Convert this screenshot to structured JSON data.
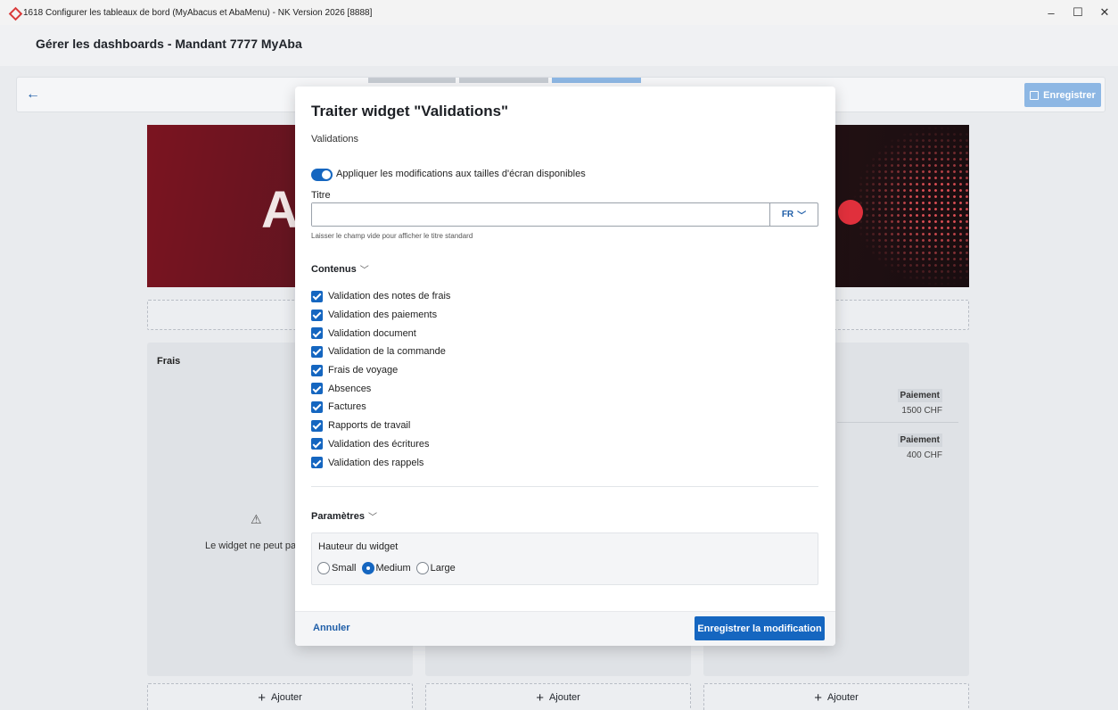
{
  "window": {
    "title": "1618 Configurer les tableaux de bord (MyAbacus et AbaMenu) - NK Version 2026 [8888]",
    "controls": {
      "minimize": "–",
      "maximize": "☐",
      "close": "✕"
    }
  },
  "header": {
    "title": "Gérer les dashboards - Mandant 7777 MyAba"
  },
  "toolbar": {
    "back_icon": "←",
    "save_label": "Enregistrer"
  },
  "dashboard": {
    "banner_letter": "A",
    "column1": {
      "title": "Frais",
      "warning_icon": "⚠",
      "warning_text": "Le widget ne peut pas"
    },
    "column3": {
      "payments": [
        {
          "label": "Paiement",
          "amount": "1500 CHF"
        },
        {
          "label": "Paiement",
          "amount": "400 CHF"
        }
      ]
    },
    "add_buttons": [
      {
        "plus": "+",
        "label": "Ajouter"
      },
      {
        "plus": "+",
        "label": "Ajouter"
      },
      {
        "plus": "+",
        "label": "Ajouter"
      }
    ]
  },
  "modal": {
    "title": "Traiter widget \"Validations\"",
    "subtitle": "Validations",
    "toggle": {
      "on": true,
      "label": "Appliquer les modifications aux tailles d'écran disponibles"
    },
    "title_field": {
      "label": "Titre",
      "value": "",
      "language": "FR",
      "hint": "Laisser le champ vide pour afficher le titre standard"
    },
    "contents": {
      "label": "Contenus",
      "items": [
        {
          "label": "Validation des notes de frais",
          "checked": true
        },
        {
          "label": "Validation des paiements",
          "checked": true
        },
        {
          "label": "Validation document",
          "checked": true
        },
        {
          "label": "Validation de la commande",
          "checked": true
        },
        {
          "label": "Frais de voyage",
          "checked": true
        },
        {
          "label": "Absences",
          "checked": true
        },
        {
          "label": "Factures",
          "checked": true
        },
        {
          "label": "Rapports de travail",
          "checked": true
        },
        {
          "label": "Validation des écritures",
          "checked": true
        },
        {
          "label": "Validation des rappels",
          "checked": true
        }
      ]
    },
    "params": {
      "label": "Paramètres",
      "height_label": "Hauteur du widget",
      "options": [
        "Small",
        "Medium",
        "Large"
      ],
      "selected": "Medium"
    },
    "footer": {
      "cancel": "Annuler",
      "confirm": "Enregistrer la modification"
    }
  },
  "colors": {
    "accent": "#1566c0",
    "link": "#1f5ea8",
    "save_disabled": "#8db7e4"
  }
}
